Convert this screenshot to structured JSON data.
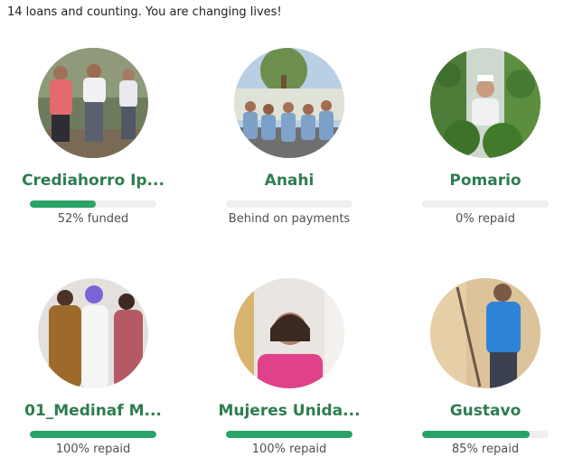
{
  "headline": "14 loans and counting. You are changing lives!",
  "colors": {
    "accent": "#2aa367",
    "name_green": "#2e7d4f",
    "track": "#efefef"
  },
  "loans": [
    {
      "name": "Crediahorro Ip...",
      "status": "52% funded",
      "progress": 0.52
    },
    {
      "name": "Anahi",
      "status": "Behind on payments",
      "progress": 0
    },
    {
      "name": "Pomario",
      "status": "0% repaid",
      "progress": 0
    },
    {
      "name": "01_Medinaf M...",
      "status": "100% repaid",
      "progress": 1.0
    },
    {
      "name": "Mujeres Unida...",
      "status": "100% repaid",
      "progress": 1.0
    },
    {
      "name": "Gustavo",
      "status": "85% repaid",
      "progress": 0.85
    }
  ]
}
